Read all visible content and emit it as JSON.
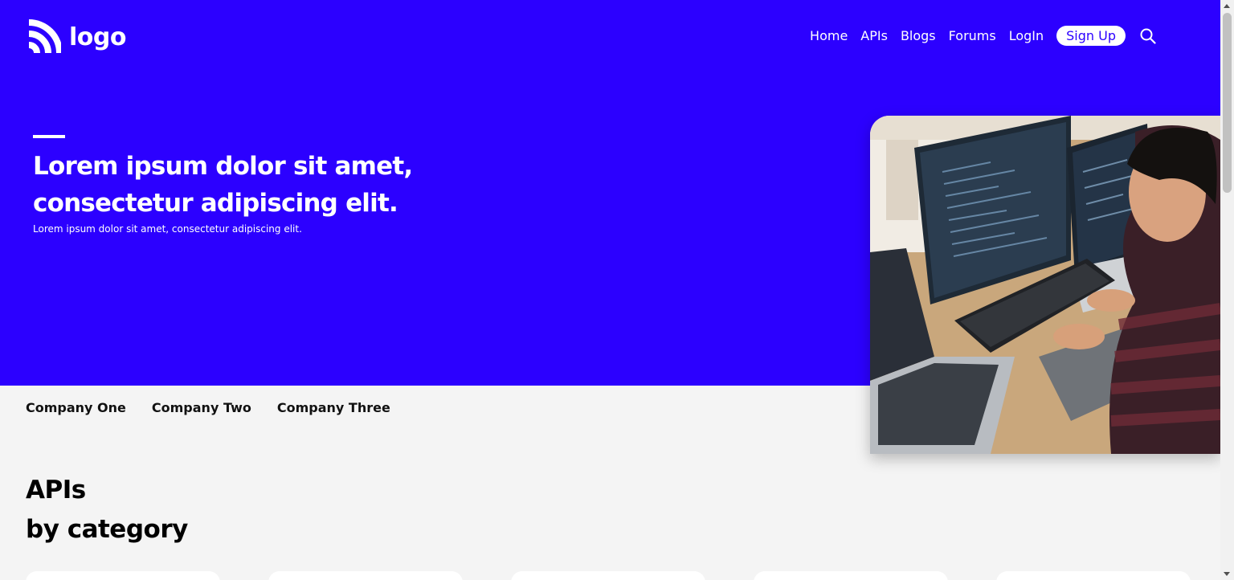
{
  "brand": {
    "logo_text": "logo",
    "accent_color": "#2c00ff"
  },
  "nav": {
    "items": [
      "Home",
      "APIs",
      "Blogs",
      "Forums",
      "LogIn"
    ],
    "signup_label": "Sign Up",
    "search_icon": "search-icon"
  },
  "hero": {
    "title": "Lorem ipsum dolor sit amet, consectetur adipiscing elit.",
    "subtitle": "Lorem ipsum dolor sit amet, consectetur adipiscing elit.",
    "image": "developer-at-computers-photo"
  },
  "companies": [
    "Company One",
    "Company Two",
    "Company Three"
  ],
  "section": {
    "title_line1": "APIs",
    "title_line2": "by category"
  }
}
